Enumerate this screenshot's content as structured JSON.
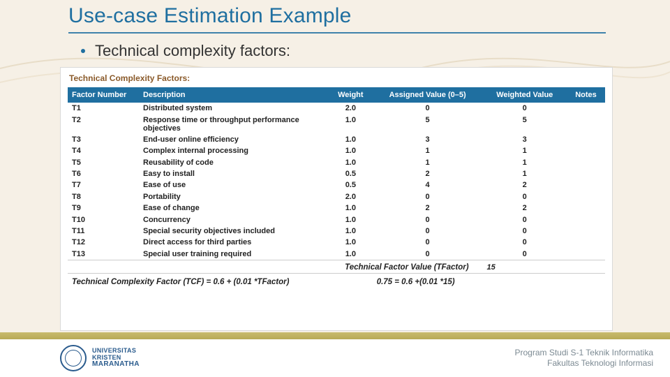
{
  "title": "Use-case Estimation Example",
  "bullet": "Technical complexity factors:",
  "panel_heading": "Technical Complexity Factors:",
  "headers": {
    "factor": "Factor Number",
    "desc": "Description",
    "weight": "Weight",
    "assigned": "Assigned Value (0–5)",
    "weighted": "Weighted Value",
    "notes": "Notes"
  },
  "rows": [
    {
      "f": "T1",
      "d": "Distributed system",
      "w": "2.0",
      "a": "0",
      "v": "0"
    },
    {
      "f": "T2",
      "d": "Response time or throughput performance objectives",
      "w": "1.0",
      "a": "5",
      "v": "5"
    },
    {
      "f": "T3",
      "d": "End-user online efficiency",
      "w": "1.0",
      "a": "3",
      "v": "3"
    },
    {
      "f": "T4",
      "d": "Complex internal processing",
      "w": "1.0",
      "a": "1",
      "v": "1"
    },
    {
      "f": "T5",
      "d": "Reusability of code",
      "w": "1.0",
      "a": "1",
      "v": "1"
    },
    {
      "f": "T6",
      "d": "Easy to install",
      "w": "0.5",
      "a": "2",
      "v": "1"
    },
    {
      "f": "T7",
      "d": "Ease of use",
      "w": "0.5",
      "a": "4",
      "v": "2"
    },
    {
      "f": "T8",
      "d": "Portability",
      "w": "2.0",
      "a": "0",
      "v": "0"
    },
    {
      "f": "T9",
      "d": "Ease of change",
      "w": "1.0",
      "a": "2",
      "v": "2"
    },
    {
      "f": "T10",
      "d": "Concurrency",
      "w": "1.0",
      "a": "0",
      "v": "0"
    },
    {
      "f": "T11",
      "d": "Special security objectives included",
      "w": "1.0",
      "a": "0",
      "v": "0"
    },
    {
      "f": "T12",
      "d": "Direct access for third parties",
      "w": "1.0",
      "a": "0",
      "v": "0"
    },
    {
      "f": "T13",
      "d": "Special user training required",
      "w": "1.0",
      "a": "0",
      "v": "0"
    }
  ],
  "tfactor_label": "Technical Factor Value (TFactor)",
  "tfactor_value": "15",
  "formula_left": "Technical Complexity Factor (TCF) = 0.6 + (0.01 *TFactor)",
  "formula_right": "0.75 = 0.6  +(0.01 *15)",
  "footer": {
    "uni1": "UNIVERSITAS",
    "uni2": "KRISTEN",
    "uni3": "MARANATHA",
    "prog1": "Program Studi S-1 Teknik Informatika",
    "prog2": "Fakultas Teknologi Informasi"
  }
}
